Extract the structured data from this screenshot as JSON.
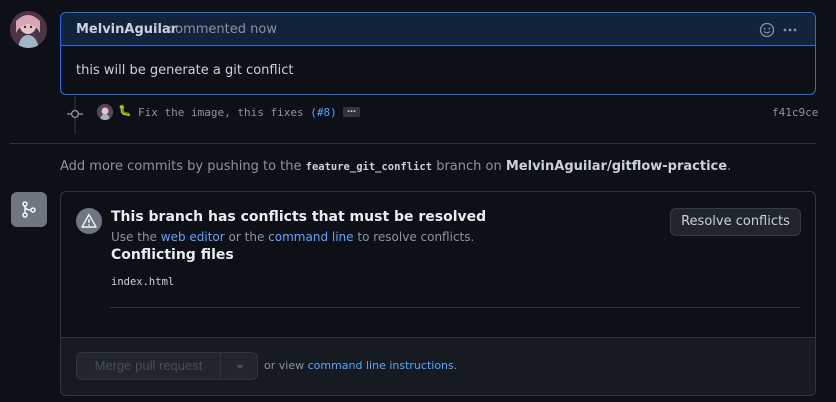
{
  "comment": {
    "author": "MelvinAguilar",
    "action": "commented now",
    "body": "this will be generate a git conflict"
  },
  "commit": {
    "emoji": "🐛",
    "message": "Fix the image, this fixes",
    "issue_ref": "(#8)",
    "ellipsis": "…",
    "sha": "f41c9ce"
  },
  "push_note": {
    "prefix": "Add more commits by pushing to the",
    "branch": "feature_git_conflict",
    "middle": "branch on",
    "repo": "MelvinAguilar/gitflow-practice",
    "suffix": "."
  },
  "conflict": {
    "title": "This branch has conflicts that must be resolved",
    "sub_prefix": "Use the",
    "web_editor_link": "web editor",
    "sub_or": "or the",
    "command_line_link": "command line",
    "sub_suffix": "to resolve conflicts.",
    "resolve_button": "Resolve conflicts",
    "files_title": "Conflicting files",
    "files": [
      "index.html"
    ]
  },
  "merge": {
    "button": "Merge pull request",
    "note_prefix": "or view",
    "note_link": "command line instructions",
    "note_suffix": "."
  },
  "colors": {
    "background": "#0d1117",
    "accent_blue": "#1f6feb",
    "link": "#58a6ff",
    "muted": "#8b949e",
    "border": "#30363d"
  }
}
